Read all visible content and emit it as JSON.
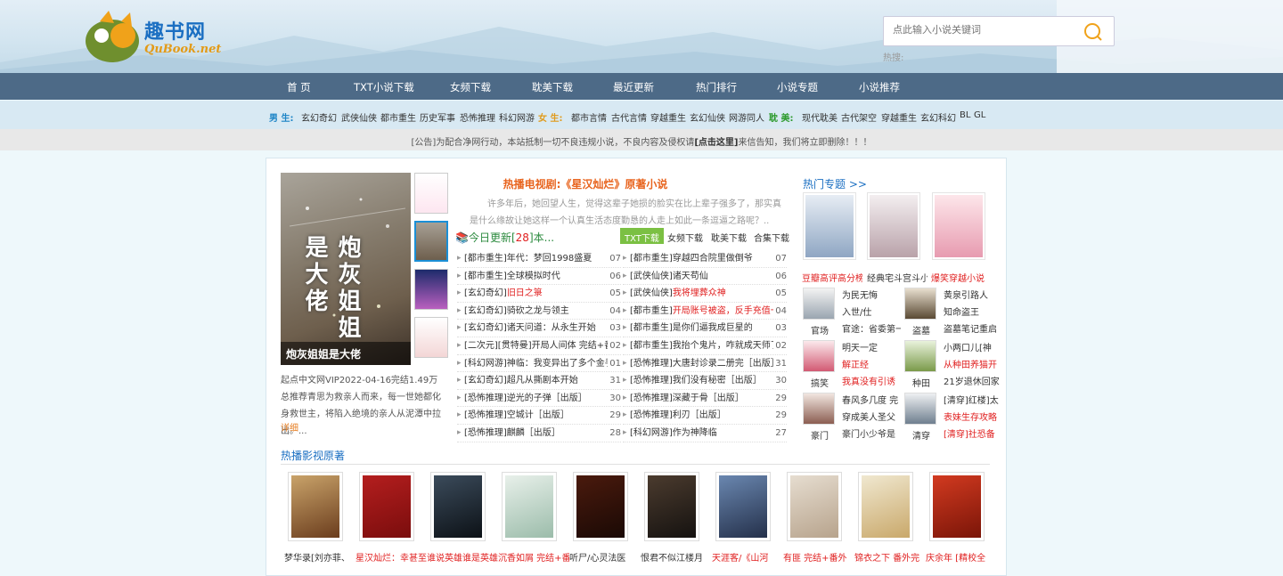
{
  "site": {
    "name": "趣书网",
    "sub": "QuBook.net"
  },
  "search": {
    "placeholder": "点此输入小说关键词",
    "hot_label": "热搜:"
  },
  "nav": [
    "首 页",
    "TXT小说下载",
    "女频下载",
    "耽美下载",
    "最近更新",
    "热门排行",
    "小说专题",
    "小说推荐"
  ],
  "categories": {
    "male_label": "男 生:",
    "male": [
      "玄幻奇幻",
      "武侠仙侠",
      "都市重生",
      "历史军事",
      "恐怖推理",
      "科幻网游"
    ],
    "female_label": "女 生:",
    "female": [
      "都市言情",
      "古代言情",
      "穿越重生",
      "玄幻仙侠",
      "网游同人"
    ],
    "danmei_label": "耽 美:",
    "danmei": [
      "现代耽美",
      "古代架空",
      "穿越重生",
      "玄幻科幻",
      "BL",
      "GL"
    ]
  },
  "notice": {
    "pre": "[公告]为配合净网行动，本站抵制一切不良违规小说，不良内容及侵权请",
    "link": "[点击这里]",
    "post": "来信告知，我们将立即删除！！！"
  },
  "featured": {
    "cover_title": "炮灰姐姐是大佬",
    "cover_caption": "炮灰姐姐是大佬",
    "desc": "起点中文网VIP2022-04-16完结1.49万总推荐青思为救亲人而来，每一世她都化身救世主，将陷入绝境的亲人从泥潭中拉出。...",
    "more": "详细"
  },
  "headline": {
    "title": "热播电视剧:《星汉灿烂》原著小说",
    "desc": "许多年后，她回望人生，觉得这辈子她损的脸实在比上辈子强多了，那实真是什么缘故让她这样一个认真生活态度勤恳的人走上如此一条逗逼之路呢？.."
  },
  "today": {
    "label": "今日更新",
    "count": "28",
    "unit": "本..."
  },
  "tabs": [
    "TXT下载",
    "女频下载",
    "耽美下载",
    "合集下载"
  ],
  "updates_left": [
    {
      "t": "[都市重生]年代：梦回1998盛夏",
      "d": "07",
      "red": false
    },
    {
      "t": "[都市重生]全球模拟时代",
      "d": "06",
      "red": false
    },
    {
      "t": "[玄幻奇幻]",
      "t2": "旧日之箓",
      "d": "05",
      "red": true
    },
    {
      "t": "[玄幻奇幻]骑砍之龙与领主",
      "d": "04",
      "red": false
    },
    {
      "t": "[玄幻奇幻]诸天问道：从永生开始",
      "d": "03",
      "red": false
    },
    {
      "t": "[二次元][贯特曼]开局人间体 完结+番",
      "d": "02",
      "red": false
    },
    {
      "t": "[科幻网游]神临：我变异出了多个金手",
      "d": "01",
      "red": false
    },
    {
      "t": "[玄幻奇幻]超凡从撕剧本开始",
      "d": "31",
      "red": false
    },
    {
      "t": "[恐怖推理]逆光的子弹［出版］",
      "d": "30",
      "red": false
    },
    {
      "t": "[恐怖推理]空城计［出版］",
      "d": "29",
      "red": false
    },
    {
      "t": "[恐怖推理]麒麟［出版］",
      "d": "28",
      "red": false
    }
  ],
  "updates_right": [
    {
      "t": "[都市重生]穿越四合院里做倒爷",
      "d": "07",
      "red": false
    },
    {
      "t": "[武侠仙侠]诸天苟仙",
      "d": "06",
      "red": false
    },
    {
      "t": "[武侠仙侠]",
      "t2": "我将埋葬众神",
      "d": "05",
      "red": true
    },
    {
      "t": "[都市重生]",
      "t2": "开局账号被盗，反手充值一百",
      "d": "04",
      "red": true
    },
    {
      "t": "[都市重生]是你们逼我成巨星的",
      "d": "03",
      "red": false
    },
    {
      "t": "[都市重生]我抬个鬼片，咋就成天师了?",
      "d": "02",
      "red": false
    },
    {
      "t": "[恐怖推理]大唐封诊录二册完［出版］",
      "d": "31",
      "red": false
    },
    {
      "t": "[恐怖推理]我们没有秘密［出版］",
      "d": "30",
      "red": false
    },
    {
      "t": "[恐怖推理]深藏于骨［出版］",
      "d": "29",
      "red": false
    },
    {
      "t": "[恐怖推理]利刃［出版］",
      "d": "29",
      "red": false
    },
    {
      "t": "[科幻网游]作为神降临",
      "d": "27",
      "red": false
    }
  ],
  "topics": {
    "title": "热门专题 >>",
    "items": [
      {
        "cap": "豆瓣高评高分榜",
        "color": "#e02020"
      },
      {
        "cap": "经典宅斗宫斗小说",
        "color": "#333333"
      },
      {
        "cap": "爆笑穿越小说",
        "color": "#e02020"
      }
    ]
  },
  "topic_books": [
    {
      "name": "官场",
      "l1": "为民无悔",
      "l2": "入世/仕",
      "l3": "官途：省委第一",
      "red": [
        false,
        false,
        false
      ]
    },
    {
      "name": "盗墓",
      "l1": "黄泉引路人",
      "l2": "知命盗王",
      "l3": "盗墓笔记重启",
      "red": [
        false,
        false,
        false
      ]
    },
    {
      "name": "搞笑",
      "l1": "明天一定",
      "l2": "解正经",
      "l3": "我真没有引诱",
      "red": [
        false,
        true,
        true
      ]
    },
    {
      "name": "种田",
      "l1": "小两口儿[神",
      "l2": "从种田养猫开",
      "l3": "21岁退休回家",
      "red": [
        false,
        true,
        false
      ]
    },
    {
      "name": "豪门",
      "l1": "春风多几度 完",
      "l2": "穿成美人圣父",
      "l3": "豪门小少爷是",
      "red": [
        false,
        false,
        false
      ]
    },
    {
      "name": "清穿",
      "l1": "[清穿]红楼]太",
      "l2": "表妹生存攻略",
      "l3": "[清穿]社恐备",
      "red": [
        false,
        true,
        true
      ]
    }
  ],
  "films": {
    "title": "热播影视原著",
    "items": [
      {
        "cap": "梦华录[刘亦菲、",
        "red": false,
        "c1": "#c9a36a",
        "c2": "#6b3d1d"
      },
      {
        "cap": "星汉灿烂：幸甚至",
        "red": true,
        "c1": "#b41e1e",
        "c2": "#7a0d0d"
      },
      {
        "cap": "谁说英雄谁是英雄系",
        "red": true,
        "c1": "#3b4b5b",
        "c2": "#0c1116"
      },
      {
        "cap": "沉香如屑 完结+番",
        "red": true,
        "c1": "#e8f0ea",
        "c2": "#9bbcaa"
      },
      {
        "cap": "听尸/心灵法医",
        "red": false,
        "c1": "#4a1a0d",
        "c2": "#1a0905"
      },
      {
        "cap": "恨君不似江楼月",
        "red": false,
        "c1": "#4b3b2e",
        "c2": "#151210"
      },
      {
        "cap": "天涯客/《山河",
        "red": true,
        "c1": "#6a87b0",
        "c2": "#24304a"
      },
      {
        "cap": "有匪 完结+番外",
        "red": true,
        "c1": "#e6ddd0",
        "c2": "#b7a38c"
      },
      {
        "cap": "锦衣之下 番外完",
        "red": true,
        "c1": "#f0e8d0",
        "c2": "#c9a86a"
      },
      {
        "cap": "庆余年 [精校全",
        "red": true,
        "c1": "#d23a20",
        "c2": "#7a1508"
      }
    ]
  },
  "colors": {
    "nav_bg": "#4d6a87",
    "accent_orange": "#e8641e",
    "link_blue": "#1b6fc2",
    "red": "#e02020",
    "green_tab": "#7bc043"
  }
}
